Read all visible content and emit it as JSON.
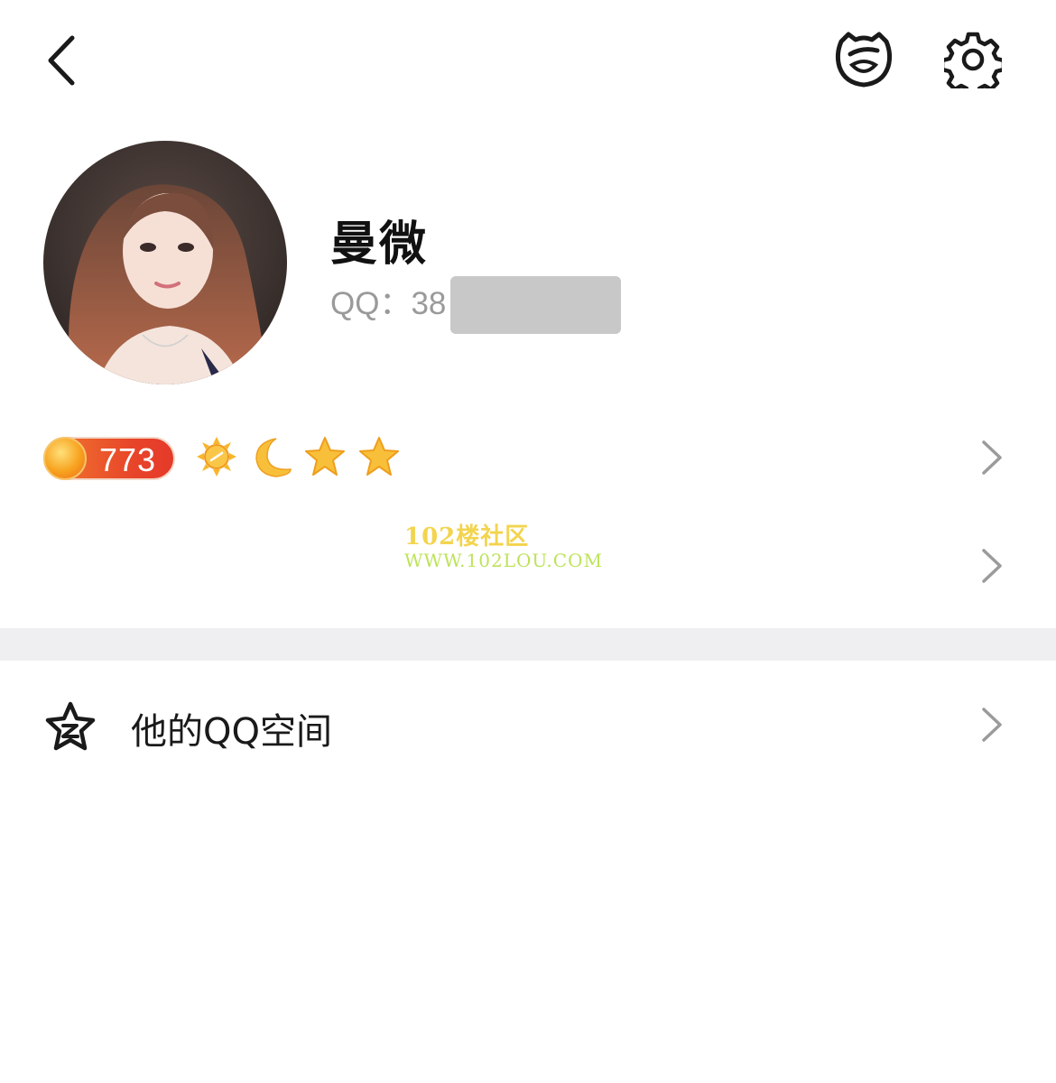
{
  "header": {
    "back_icon": "chevron-left-icon",
    "mascot_icon": "penguin-face-icon",
    "settings_icon": "gear-icon"
  },
  "profile": {
    "name": "曼微",
    "qq_label": "QQ：38",
    "qq_redacted": true
  },
  "level": {
    "vip_number": "773",
    "icons": [
      "sun-icon",
      "moon-icon",
      "star-icon",
      "star-icon"
    ]
  },
  "watermark": {
    "title": "102楼社区",
    "url": "WWW.102LOU.COM"
  },
  "menu": {
    "qzone_label": "他的QQ空间",
    "qzone_icon": "qzone-star-icon"
  },
  "colors": {
    "background": "#ffffff",
    "divider": "#efeff2",
    "secondary_text": "#9a9a9a",
    "chevron": "#9b9b9b",
    "vip_orange": "#e8442a"
  }
}
